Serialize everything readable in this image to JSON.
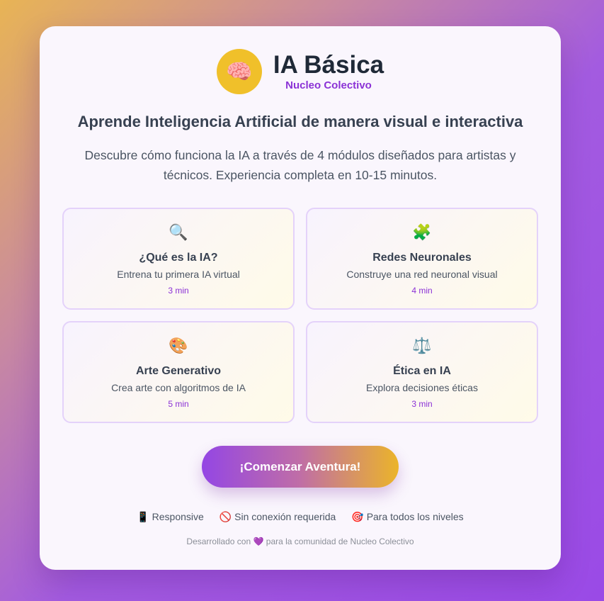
{
  "header": {
    "logo_icon": "🧠",
    "title": "IA Básica",
    "subtitle": "Nucleo Colectivo"
  },
  "headline": "Aprende Inteligencia Artificial de manera visual e interactiva",
  "description": "Descubre cómo funciona la IA a través de 4 módulos diseñados para artistas y técnicos. Experiencia completa en 10-15 minutos.",
  "modules": [
    {
      "icon": "🔍",
      "icon_name": "magnifier-icon",
      "title": "¿Qué es la IA?",
      "description": "Entrena tu primera IA virtual",
      "duration": "3 min"
    },
    {
      "icon": "🧩",
      "icon_name": "puzzle-icon",
      "title": "Redes Neuronales",
      "description": "Construye una red neuronal visual",
      "duration": "4 min"
    },
    {
      "icon": "🎨",
      "icon_name": "palette-icon",
      "title": "Arte Generativo",
      "description": "Crea arte con algoritmos de IA",
      "duration": "5 min"
    },
    {
      "icon": "⚖️",
      "icon_name": "scales-icon",
      "title": "Ética en IA",
      "description": "Explora decisiones éticas",
      "duration": "3 min"
    }
  ],
  "start_button": "¡Comenzar Aventura!",
  "features": [
    {
      "icon": "📱",
      "label": "Responsive"
    },
    {
      "icon": "🚫",
      "label": "Sin conexión requerida"
    },
    {
      "icon": "🎯",
      "label": "Para todos los niveles"
    }
  ],
  "footer": {
    "prefix": "Desarrollado con",
    "heart": "💜",
    "suffix": "para la comunidad de Nucleo Colectivo"
  },
  "colors": {
    "accent_purple": "#8b32d6",
    "logo_yellow": "#f0c02a",
    "button_gradient_start": "#9446e4",
    "button_gradient_end": "#ebb42a"
  }
}
